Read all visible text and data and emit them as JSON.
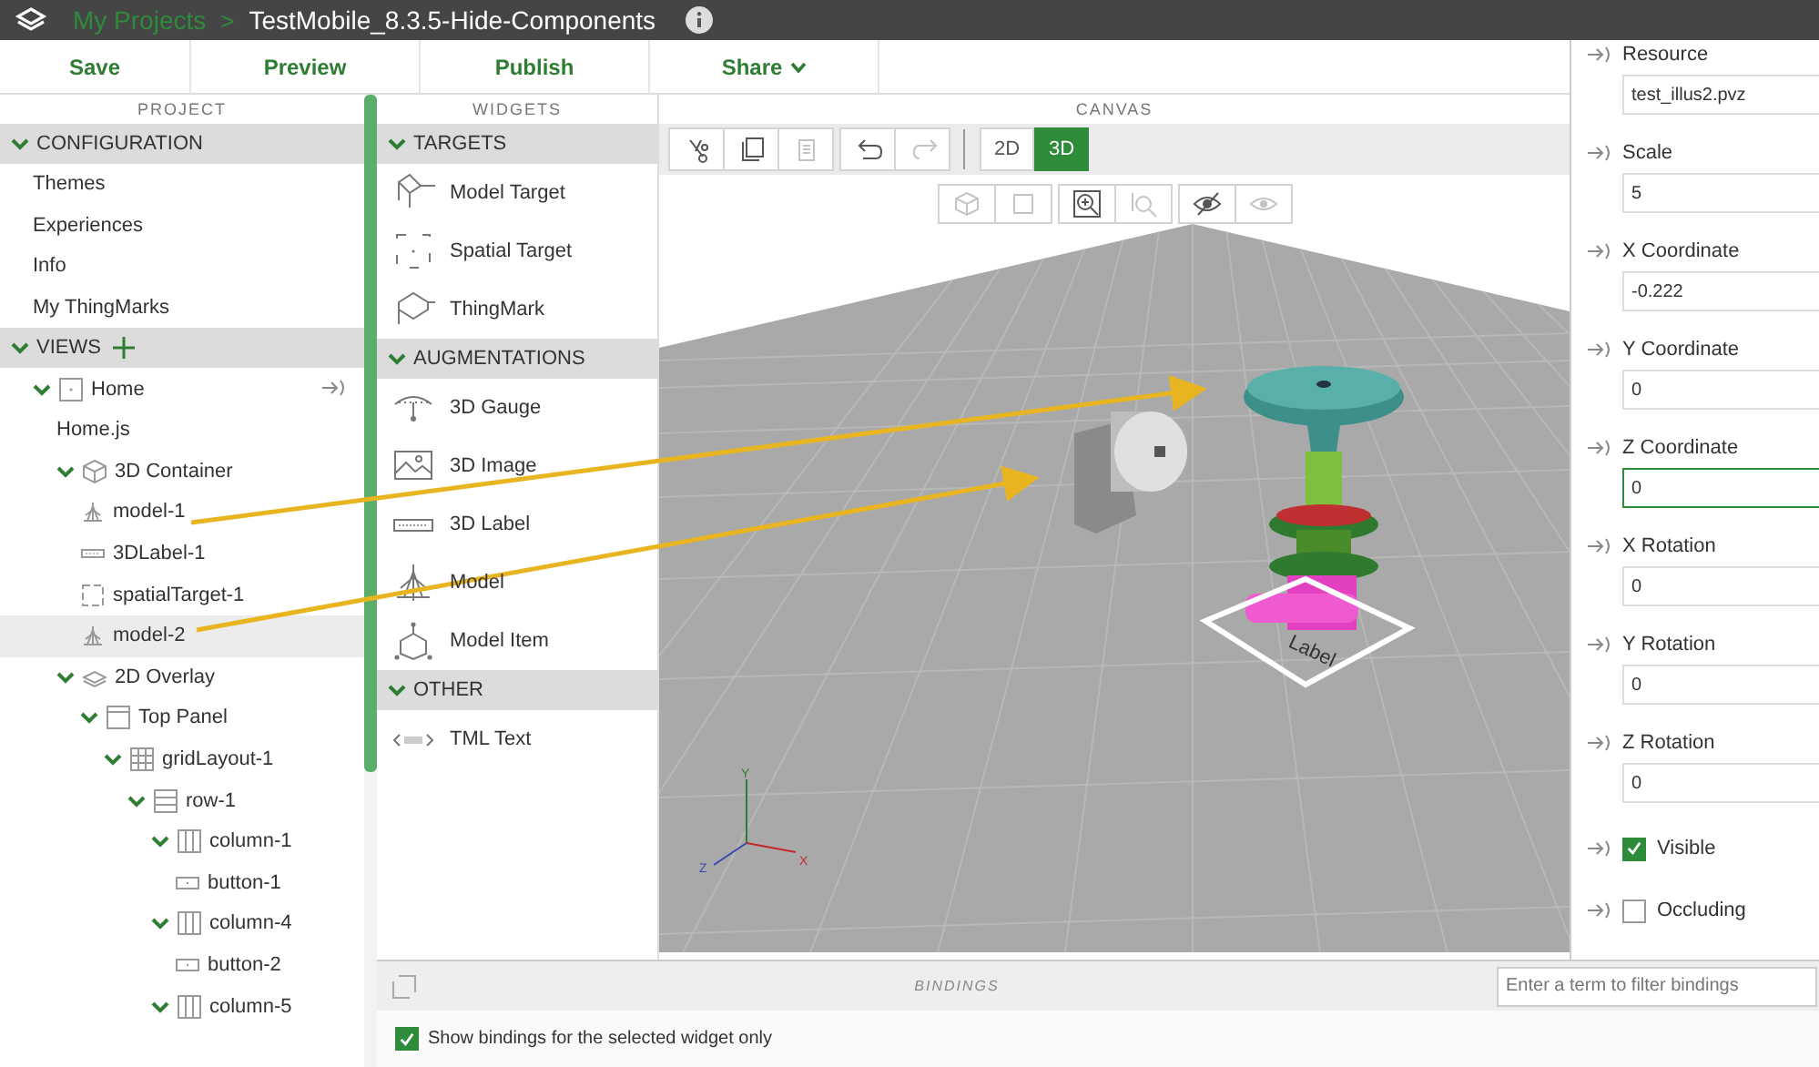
{
  "title_bar": {
    "breadcrumb": "My Projects",
    "separator": ">",
    "title": "TestMobile_8.3.5-Hide-Components"
  },
  "toolbar": [
    {
      "label": "Save",
      "menu": false
    },
    {
      "label": "Preview",
      "menu": false
    },
    {
      "label": "Publish",
      "menu": false
    },
    {
      "label": "Share",
      "menu": true
    }
  ],
  "project": {
    "heading": "PROJECT",
    "sections": [
      {
        "label": "CONFIGURATION",
        "expanded": true,
        "can_add": false,
        "items": [
          {
            "label": "Themes",
            "kind": "plain",
            "selected": false
          },
          {
            "label": "Experiences",
            "kind": "plain",
            "selected": false
          },
          {
            "label": "Info",
            "kind": "plain",
            "selected": false
          },
          {
            "label": "My ThingMarks",
            "kind": "plain",
            "selected": false
          }
        ]
      },
      {
        "label": "VIEWS",
        "expanded": true,
        "can_add": true,
        "items": [
          {
            "label": "Home",
            "kind": "view",
            "selected": false,
            "expanded": true,
            "children": [
              {
                "label": "Home.js",
                "kind": "script",
                "selected": false
              },
              {
                "label": "3D Container",
                "kind": "container3d",
                "selected": false,
                "expanded": true,
                "children": [
                  {
                    "label": "model-1",
                    "kind": "model",
                    "selected": false
                  },
                  {
                    "label": "3DLabel-1",
                    "kind": "label3d",
                    "selected": false
                  },
                  {
                    "label": "spatialTarget-1",
                    "kind": "spatial",
                    "selected": false
                  },
                  {
                    "label": "model-2",
                    "kind": "model",
                    "selected": true
                  }
                ]
              },
              {
                "label": "2D Overlay",
                "kind": "overlay2d",
                "selected": false,
                "expanded": true,
                "children": [
                  {
                    "label": "Top Panel",
                    "kind": "panel",
                    "selected": false,
                    "expanded": true,
                    "children": [
                      {
                        "label": "gridLayout-1",
                        "kind": "grid",
                        "selected": false,
                        "expanded": true,
                        "children": [
                          {
                            "label": "row-1",
                            "kind": "row",
                            "selected": false,
                            "expanded": true,
                            "children": [
                              {
                                "label": "column-1",
                                "kind": "column",
                                "selected": false,
                                "expanded": true,
                                "children": [
                                  {
                                    "label": "button-1",
                                    "kind": "button",
                                    "selected": false
                                  }
                                ]
                              },
                              {
                                "label": "column-4",
                                "kind": "column",
                                "selected": false,
                                "expanded": true,
                                "children": [
                                  {
                                    "label": "button-2",
                                    "kind": "button",
                                    "selected": false
                                  }
                                ]
                              },
                              {
                                "label": "column-5",
                                "kind": "column",
                                "selected": false,
                                "expanded": true
                              }
                            ]
                          }
                        ]
                      }
                    ]
                  }
                ]
              }
            ]
          }
        ]
      }
    ]
  },
  "widgets": {
    "heading": "WIDGETS",
    "groups": [
      {
        "label": "TARGETS",
        "expanded": true,
        "items": [
          {
            "label": "Model Target",
            "kind": "model-target"
          },
          {
            "label": "Spatial Target",
            "kind": "spatial"
          },
          {
            "label": "ThingMark",
            "kind": "thingmark"
          }
        ]
      },
      {
        "label": "AUGMENTATIONS",
        "expanded": true,
        "items": [
          {
            "label": "3D Gauge",
            "kind": "gauge"
          },
          {
            "label": "3D Image",
            "kind": "image"
          },
          {
            "label": "3D Label",
            "kind": "label3d"
          },
          {
            "label": "Model",
            "kind": "model"
          },
          {
            "label": "Model Item",
            "kind": "model-item"
          }
        ]
      },
      {
        "label": "OTHER",
        "expanded": true,
        "items": [
          {
            "label": "TML Text",
            "kind": "tml"
          }
        ]
      }
    ]
  },
  "canvas": {
    "heading": "CANVAS",
    "tools": [
      [
        {
          "kind": "cut",
          "disabled": false
        },
        {
          "kind": "copy",
          "disabled": false
        },
        {
          "kind": "paste",
          "disabled": true
        }
      ],
      [
        {
          "kind": "undo",
          "disabled": false
        },
        {
          "kind": "redo",
          "disabled": true
        }
      ]
    ],
    "modes": [
      {
        "label": "2D",
        "selected": false
      },
      {
        "label": "3D",
        "selected": true
      }
    ],
    "view_tools": [
      [
        {
          "kind": "cube",
          "disabled": true
        },
        {
          "kind": "frame",
          "disabled": true
        }
      ],
      [
        {
          "kind": "zoom-in",
          "disabled": false
        },
        {
          "kind": "zoom-select",
          "disabled": true
        }
      ],
      [
        {
          "kind": "hide",
          "disabled": false
        },
        {
          "kind": "show",
          "disabled": true
        }
      ]
    ],
    "scene": {
      "label_text": "Label",
      "axes": {
        "y": "Y",
        "z": "Z",
        "x": "X"
      }
    }
  },
  "properties": {
    "fields": [
      {
        "label": "Resource",
        "value": "test_illus2.pvz",
        "focused": false
      },
      {
        "label": "Scale",
        "value": "5",
        "focused": false
      },
      {
        "label": "X Coordinate",
        "value": "-0.222",
        "focused": false
      },
      {
        "label": "Y Coordinate",
        "value": "0",
        "focused": false
      },
      {
        "label": "Z Coordinate",
        "value": "0",
        "focused": true
      },
      {
        "label": "X Rotation",
        "value": "0",
        "focused": false
      },
      {
        "label": "Y Rotation",
        "value": "0",
        "focused": false
      },
      {
        "label": "Z Rotation",
        "value": "0",
        "focused": false
      }
    ],
    "checkboxes": [
      {
        "label": "Visible",
        "checked": true
      },
      {
        "label": "Occluding",
        "checked": false
      }
    ]
  },
  "bindings": {
    "title": "BINDINGS",
    "filter": {
      "placeholder": "Enter a term to filter bindings"
    },
    "selected_only": {
      "label": "Show bindings for the selected widget only",
      "checked": true
    }
  }
}
